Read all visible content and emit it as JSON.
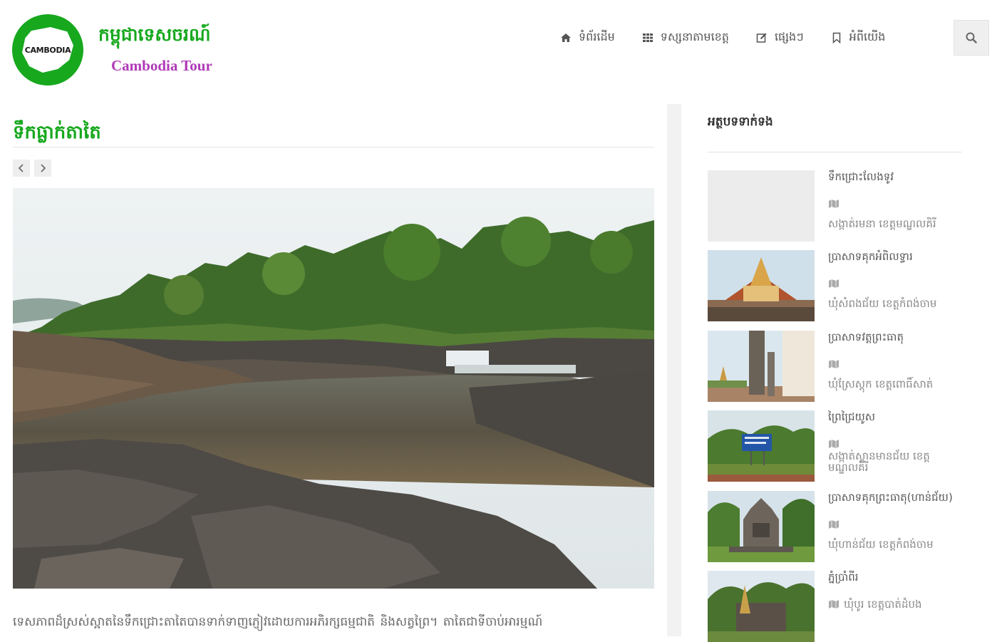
{
  "header": {
    "logo_text": "CAMBODIA",
    "site_title_km": "កម្ពុជាទេសចរណ៍",
    "site_title_en": "Cambodia Tour",
    "nav": [
      {
        "label": "ទំព័រដើម",
        "icon": "home-icon"
      },
      {
        "label": "ទស្សនាតាមខេត្ត",
        "icon": "grid-icon"
      },
      {
        "label": "ផ្សេងៗ",
        "icon": "edit-icon"
      },
      {
        "label": "អំពីយើង",
        "icon": "bookmark-icon"
      }
    ],
    "search_icon": "search-icon"
  },
  "post": {
    "title": "ទឹកធ្លាក់តាតៃ",
    "prev_icon": "chevron-left-icon",
    "next_icon": "chevron-right-icon",
    "body_text": "ទេសភាពដ៏ស្រស់ស្អាតនៃទឹកជ្រោះតាតៃបានទាក់ទាញភ្ញៀវដោយការអភិរក្សធម្មជាតិ      និងសត្វព្រៃ។     តាតៃជាទីចាប់អារម្មណ៍"
  },
  "sidebar": {
    "title": "អត្ថបទទាក់ទង",
    "items": [
      {
        "title": "ទឹកជ្រោះលែងទូវ",
        "location": "សង្កាត់រមនា ខេត្តមណ្ឌលគិរី"
      },
      {
        "title": "ប្រាសាទគុកអំពិលទ្វារ",
        "location": "ឃុំសំពងជ័យ ខេត្តកំពង់ចាម"
      },
      {
        "title": "ប្រាសាទវត្តព្រះធាតុ",
        "location": "ឃុំស្រែស្តុក ខេត្តពោធិ៍សាត់"
      },
      {
        "title": "ព្រៃជ្រៃយូស",
        "location": "សង្កាត់ស្ពានមានជ័យ ខេត្តមណ្ឌលគិរី"
      },
      {
        "title": "ប្រាសាទគុកព្រះធាតុ(ហាន់ជ័យ)",
        "location": "ឃុំហាន់ជ័យ ខេត្តកំពង់ចាម"
      },
      {
        "title": "ភ្នំប្រាំពីរ",
        "location": "ឃុំបូរ ខេត្តបាត់ដំបង"
      }
    ]
  },
  "colors": {
    "brand_green": "#17a81e",
    "brand_purple": "#b03ab8"
  }
}
